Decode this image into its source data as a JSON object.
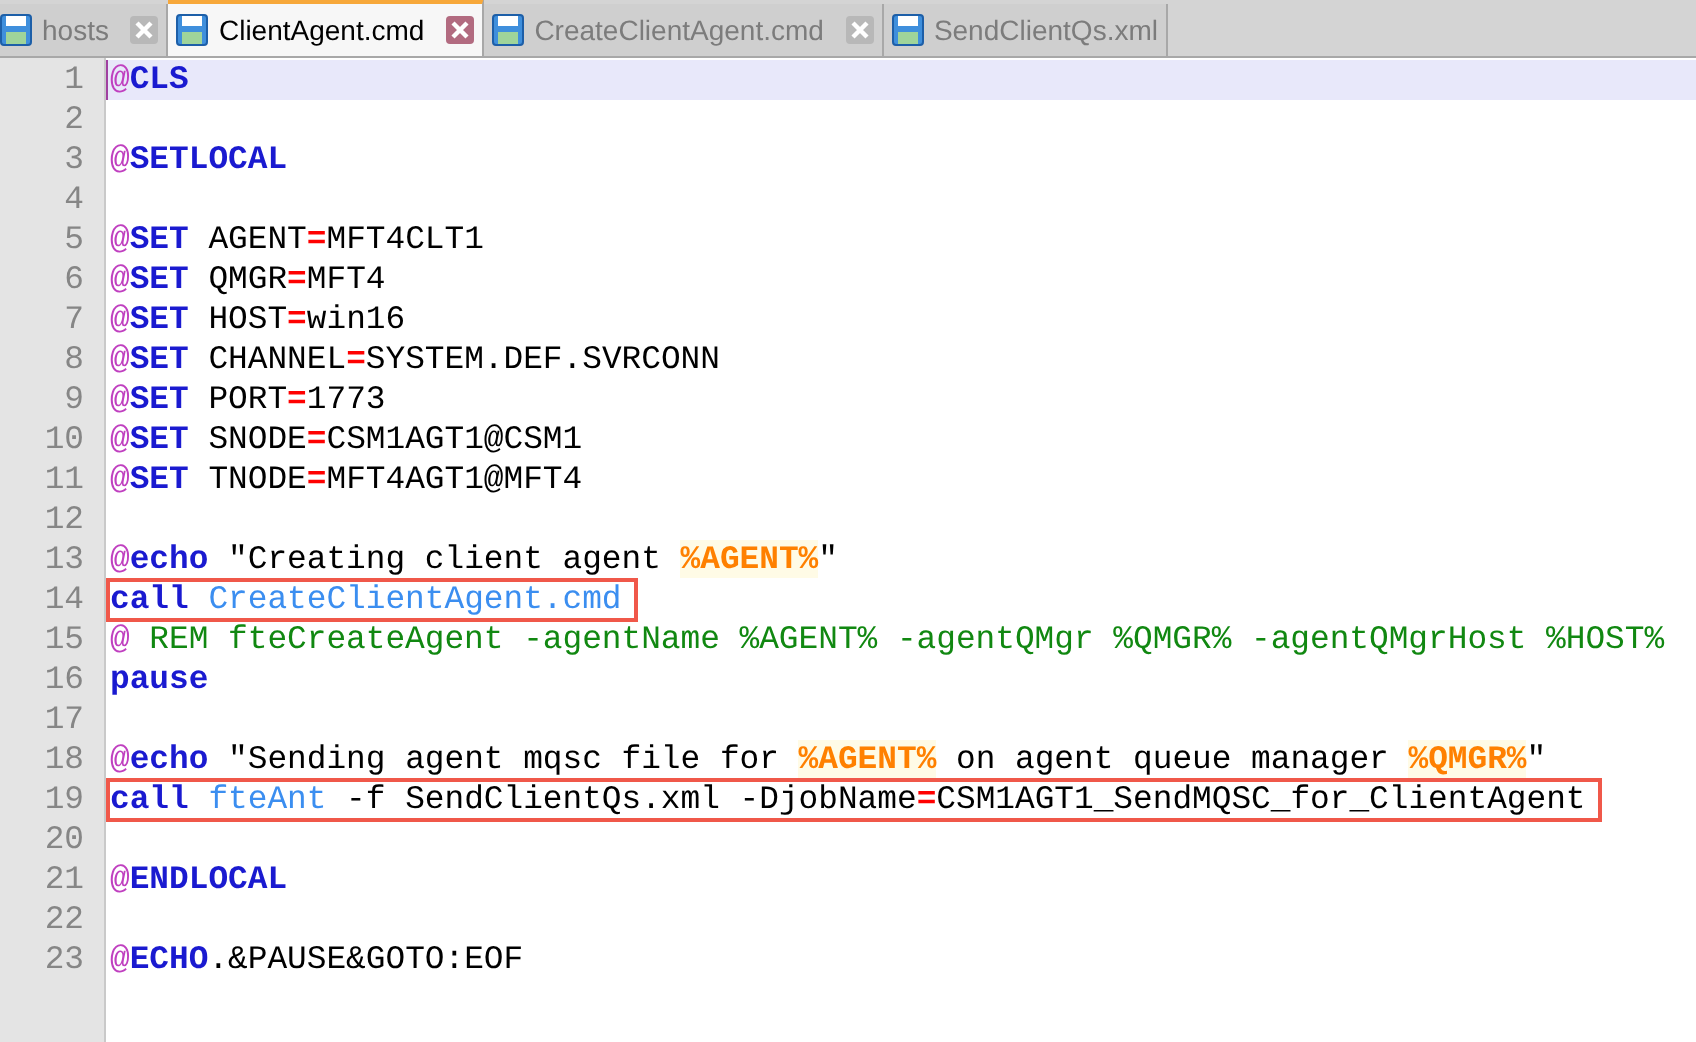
{
  "tabs": [
    {
      "label": "hosts",
      "selected": false,
      "close_button": true
    },
    {
      "label": "ClientAgent.cmd",
      "selected": true,
      "close_button": true
    },
    {
      "label": "CreateClientAgent.cmd",
      "selected": false,
      "close_button": true
    },
    {
      "label": "SendClientQs.xml",
      "selected": false,
      "close_button": false
    }
  ],
  "editor": {
    "lines": [
      {
        "number": "1",
        "current": true,
        "boxed": false,
        "tokens": [
          {
            "kind": "at",
            "text": "@"
          },
          {
            "kind": "keyword",
            "text": "CLS"
          }
        ]
      },
      {
        "number": "2",
        "current": false
      },
      {
        "number": "3",
        "current": false,
        "boxed": false,
        "tokens": [
          {
            "kind": "at",
            "text": "@"
          },
          {
            "kind": "keyword",
            "text": "SETLOCAL"
          }
        ]
      },
      {
        "number": "4",
        "current": false
      },
      {
        "number": "5",
        "current": false,
        "boxed": false,
        "tokens": [
          {
            "kind": "at",
            "text": "@"
          },
          {
            "kind": "keyword",
            "text": "SET"
          },
          {
            "kind": "plain",
            "text": " AGENT"
          },
          {
            "kind": "operator",
            "text": "="
          },
          {
            "kind": "plain",
            "text": "MFT4CLT1"
          }
        ]
      },
      {
        "number": "6",
        "current": false,
        "boxed": false,
        "tokens": [
          {
            "kind": "at",
            "text": "@"
          },
          {
            "kind": "keyword",
            "text": "SET"
          },
          {
            "kind": "plain",
            "text": " QMGR"
          },
          {
            "kind": "operator",
            "text": "="
          },
          {
            "kind": "plain",
            "text": "MFT4"
          }
        ]
      },
      {
        "number": "7",
        "current": false,
        "boxed": false,
        "tokens": [
          {
            "kind": "at",
            "text": "@"
          },
          {
            "kind": "keyword",
            "text": "SET"
          },
          {
            "kind": "plain",
            "text": " HOST"
          },
          {
            "kind": "operator",
            "text": "="
          },
          {
            "kind": "plain",
            "text": "win16"
          }
        ]
      },
      {
        "number": "8",
        "current": false,
        "boxed": false,
        "tokens": [
          {
            "kind": "at",
            "text": "@"
          },
          {
            "kind": "keyword",
            "text": "SET"
          },
          {
            "kind": "plain",
            "text": " CHANNEL"
          },
          {
            "kind": "operator",
            "text": "="
          },
          {
            "kind": "plain",
            "text": "SYSTEM.DEF.SVRCONN"
          }
        ]
      },
      {
        "number": "9",
        "current": false,
        "boxed": false,
        "tokens": [
          {
            "kind": "at",
            "text": "@"
          },
          {
            "kind": "keyword",
            "text": "SET"
          },
          {
            "kind": "plain",
            "text": " PORT"
          },
          {
            "kind": "operator",
            "text": "="
          },
          {
            "kind": "plain",
            "text": "1773"
          }
        ]
      },
      {
        "number": "10",
        "current": false,
        "boxed": false,
        "tokens": [
          {
            "kind": "at",
            "text": "@"
          },
          {
            "kind": "keyword",
            "text": "SET"
          },
          {
            "kind": "plain",
            "text": " SNODE"
          },
          {
            "kind": "operator",
            "text": "="
          },
          {
            "kind": "plain",
            "text": "CSM1AGT1@CSM1"
          }
        ]
      },
      {
        "number": "11",
        "current": false,
        "boxed": false,
        "tokens": [
          {
            "kind": "at",
            "text": "@"
          },
          {
            "kind": "keyword",
            "text": "SET"
          },
          {
            "kind": "plain",
            "text": " TNODE"
          },
          {
            "kind": "operator",
            "text": "="
          },
          {
            "kind": "plain",
            "text": "MFT4AGT1@MFT4"
          }
        ]
      },
      {
        "number": "12",
        "current": false
      },
      {
        "number": "13",
        "current": false,
        "boxed": false,
        "tokens": [
          {
            "kind": "at",
            "text": "@"
          },
          {
            "kind": "keyword",
            "text": "echo"
          },
          {
            "kind": "plain",
            "text": " \"Creating client agent "
          },
          {
            "kind": "variable",
            "text": "%AGENT%"
          },
          {
            "kind": "plain",
            "text": "\""
          }
        ]
      },
      {
        "number": "14",
        "current": false,
        "boxed": true,
        "tokens": [
          {
            "kind": "keyword",
            "text": "call"
          },
          {
            "kind": "command",
            "text": " CreateClientAgent.cmd"
          }
        ]
      },
      {
        "number": "15",
        "current": false,
        "boxed": false,
        "tokens": [
          {
            "kind": "at",
            "text": "@"
          },
          {
            "kind": "comment",
            "text": " REM fteCreateAgent -agentName %AGENT% -agentQMgr %QMGR% -agentQMgrHost %HOST%"
          }
        ]
      },
      {
        "number": "16",
        "current": false,
        "boxed": false,
        "tokens": [
          {
            "kind": "keyword",
            "text": "pause"
          }
        ]
      },
      {
        "number": "17",
        "current": false
      },
      {
        "number": "18",
        "current": false,
        "boxed": false,
        "tokens": [
          {
            "kind": "at",
            "text": "@"
          },
          {
            "kind": "keyword",
            "text": "echo"
          },
          {
            "kind": "plain",
            "text": " \"Sending agent mqsc file for "
          },
          {
            "kind": "variable",
            "text": "%AGENT%"
          },
          {
            "kind": "plain",
            "text": " on agent queue manager "
          },
          {
            "kind": "variable",
            "text": "%QMGR%"
          },
          {
            "kind": "plain",
            "text": "\""
          }
        ]
      },
      {
        "number": "19",
        "current": false,
        "boxed": true,
        "tokens": [
          {
            "kind": "keyword",
            "text": "call"
          },
          {
            "kind": "command",
            "text": " fteAnt"
          },
          {
            "kind": "plain",
            "text": " -f SendClientQs.xml -DjobName"
          },
          {
            "kind": "operator",
            "text": "="
          },
          {
            "kind": "plain",
            "text": "CSM1AGT1_SendMQSC_for_ClientAgent"
          }
        ]
      },
      {
        "number": "20",
        "current": false
      },
      {
        "number": "21",
        "current": false,
        "boxed": false,
        "tokens": [
          {
            "kind": "at",
            "text": "@"
          },
          {
            "kind": "keyword",
            "text": "ENDLOCAL"
          }
        ]
      },
      {
        "number": "22",
        "current": false
      },
      {
        "number": "23",
        "current": false,
        "boxed": false,
        "tokens": [
          {
            "kind": "at",
            "text": "@"
          },
          {
            "kind": "keyword",
            "text": "ECHO"
          },
          {
            "kind": "plain",
            "text": ".&PAUSE&GOTO:EOF"
          }
        ]
      }
    ]
  }
}
